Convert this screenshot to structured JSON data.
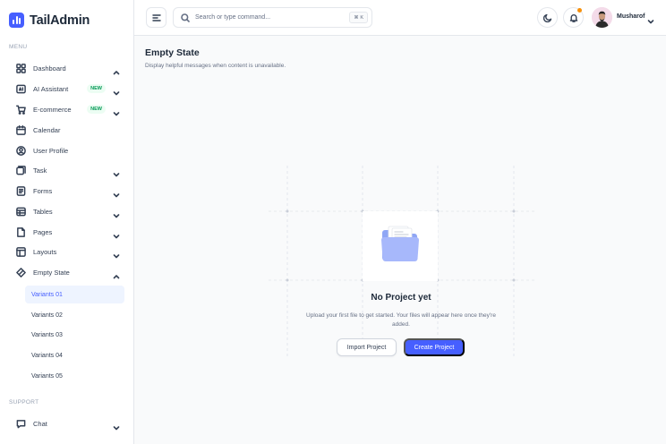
{
  "app": {
    "name": "TailAdmin",
    "brand_color": "#465fff"
  },
  "sidebar": {
    "menu_label": "MENU",
    "support_label": "SUPPORT",
    "items": [
      {
        "label": "Dashboard",
        "icon": "grid-icon",
        "chevron": "up"
      },
      {
        "label": "AI Assistant",
        "icon": "ai-icon",
        "badge": "NEW",
        "chevron": "down"
      },
      {
        "label": "E-commerce",
        "icon": "cart-icon",
        "badge": "NEW",
        "chevron": "down"
      },
      {
        "label": "Calendar",
        "icon": "calendar-icon"
      },
      {
        "label": "User Profile",
        "icon": "user-circle-icon"
      },
      {
        "label": "Task",
        "icon": "task-icon",
        "chevron": "down"
      },
      {
        "label": "Forms",
        "icon": "forms-icon",
        "chevron": "down"
      },
      {
        "label": "Tables",
        "icon": "table-icon",
        "chevron": "down"
      },
      {
        "label": "Pages",
        "icon": "pages-icon",
        "chevron": "down"
      },
      {
        "label": "Layouts",
        "icon": "layout-icon",
        "chevron": "down"
      },
      {
        "label": "Empty State",
        "icon": "empty-state-icon",
        "chevron": "up"
      }
    ],
    "sub_items": [
      {
        "label": "Variants 01",
        "active": true
      },
      {
        "label": "Variants 02"
      },
      {
        "label": "Variants 03"
      },
      {
        "label": "Variants 04"
      },
      {
        "label": "Variants 05"
      }
    ],
    "support_items": [
      {
        "label": "Chat",
        "icon": "chat-icon",
        "chevron": "down"
      }
    ]
  },
  "header": {
    "search_placeholder": "Search or type command...",
    "search_shortcut": "⌘ K",
    "user_name": "Musharof",
    "notification_dot_color": "#f79009"
  },
  "page": {
    "title": "Empty State",
    "description": "Display helpful messages when content is unavailable."
  },
  "empty_state": {
    "title": "No Project yet",
    "description": "Upload your first file to get started. Your files will appear here once they're added.",
    "secondary_button": "Import Project",
    "primary_button": "Create Project"
  }
}
